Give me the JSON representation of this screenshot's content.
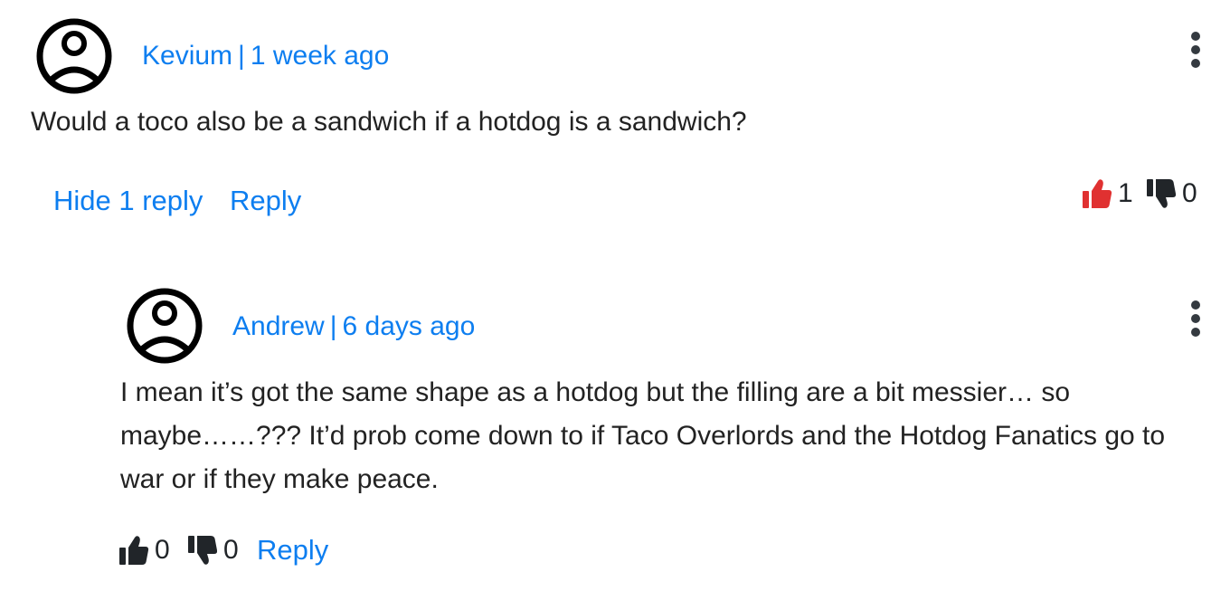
{
  "comments": [
    {
      "author": "Kevium",
      "separator": "|",
      "time": "1 week ago",
      "text": "Would a toco also be a sandwich if a hotdog is a sandwich?",
      "hide_replies_label": "Hide 1 reply",
      "reply_label": "Reply",
      "likes": "1",
      "dislikes": "0",
      "liked": true,
      "like_color": "#e03131",
      "avatar_icon": "user-circle-icon",
      "menu_icon": "kebab-menu-icon"
    }
  ],
  "replies": [
    {
      "author": "Andrew",
      "separator": "|",
      "time": "6 days ago",
      "text": "I mean it’s got the same shape as a hotdog but the filling are a bit messier… so maybe……??? It’d prob come down to if Taco Overlords and the Hotdog Fanatics go to war or if they make peace.",
      "reply_label": "Reply",
      "likes": "0",
      "dislikes": "0",
      "liked": false,
      "avatar_icon": "user-circle-icon",
      "menu_icon": "kebab-menu-icon"
    }
  ],
  "colors": {
    "link": "#0d7ef0",
    "icon": "#212529",
    "liked": "#e03131"
  }
}
